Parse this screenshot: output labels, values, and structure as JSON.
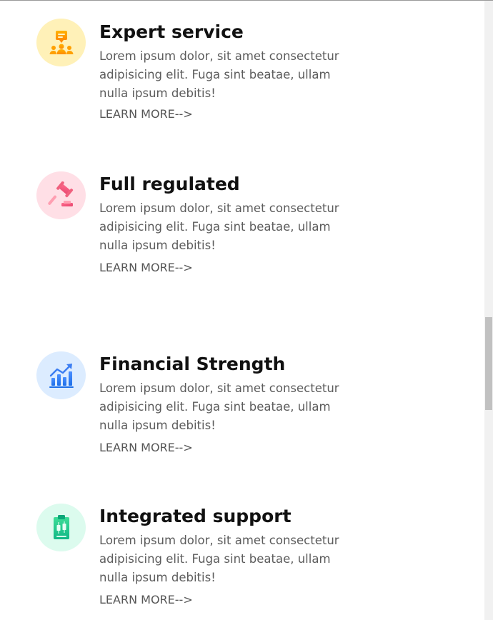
{
  "features": [
    {
      "title": "Expert service",
      "description": "Lorem ipsum dolor, sit amet consectetur adipisicing elit. Fuga sint beatae, ullam nulla ipsum debitis!",
      "link": "LEARN MORE-->",
      "icon": "support-team-icon",
      "icon_bg": "#fff1b8",
      "icon_color": "#f5a300"
    },
    {
      "title": "Full regulated",
      "description": "Lorem ipsum dolor, sit amet consectetur adipisicing elit. Fuga sint beatae, ullam nulla ipsum debitis!",
      "link": "LEARN MORE-->",
      "icon": "gavel-icon",
      "icon_bg": "#ffdfe6",
      "icon_color": "#f0607e"
    },
    {
      "title": "Financial Strength",
      "description": "Lorem ipsum dolor, sit amet consectetur adipisicing elit. Fuga sint beatae, ullam nulla ipsum debitis!",
      "link": "LEARN MORE-->",
      "icon": "growth-chart-icon",
      "icon_bg": "#dcecff",
      "icon_color": "#2d7df0"
    },
    {
      "title": "Integrated support",
      "description": "Lorem ipsum dolor, sit amet consectetur adipisicing elit. Fuga sint beatae, ullam nulla ipsum debitis!",
      "link": "LEARN MORE-->",
      "icon": "clipboard-chart-icon",
      "icon_bg": "#dcfbee",
      "icon_color": "#20c58a"
    }
  ]
}
